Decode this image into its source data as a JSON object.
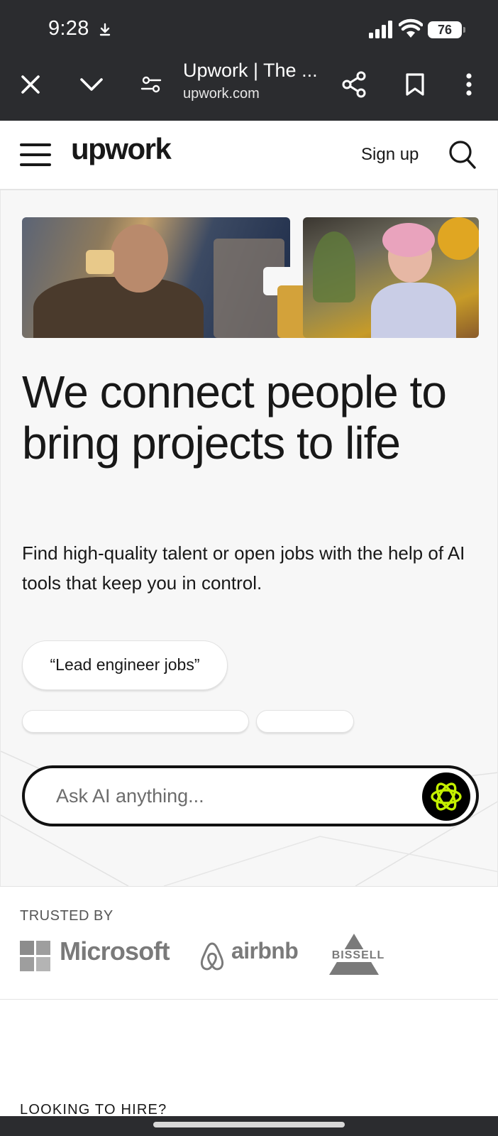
{
  "status_bar": {
    "time": "9:28",
    "battery": "76",
    "icons": [
      "download-icon",
      "signal-icon",
      "wifi-icon",
      "battery-icon"
    ]
  },
  "browser": {
    "page_title": "Upwork | The ...",
    "url": "upwork.com",
    "icons": [
      "close-icon",
      "chevron-down-icon",
      "tune-icon",
      "share-icon",
      "bookmark-icon",
      "more-vertical-icon"
    ]
  },
  "header": {
    "logo": "upwork",
    "signup_label": "Sign up",
    "icons": [
      "hamburger-menu-icon",
      "search-icon"
    ]
  },
  "hero": {
    "headline": "We connect people to bring projects to life",
    "subhead": "Find high-quality talent or open jobs with the help of AI tools that keep you in control.",
    "suggestion_chip": "“Lead engineer jobs”",
    "ask_placeholder": "Ask AI anything...",
    "ai_icon": "ai-sparkle-icon"
  },
  "trusted": {
    "label": "TRUSTED BY",
    "brands": [
      "Microsoft",
      "airbnb",
      "BISSELL"
    ]
  },
  "hire": {
    "label": "LOOKING TO HIRE?"
  },
  "colors": {
    "browser_chrome": "#2b2c2f",
    "text": "#181818",
    "ai_accent": "#c4f000",
    "logo_gray": "#7a7a7a"
  }
}
